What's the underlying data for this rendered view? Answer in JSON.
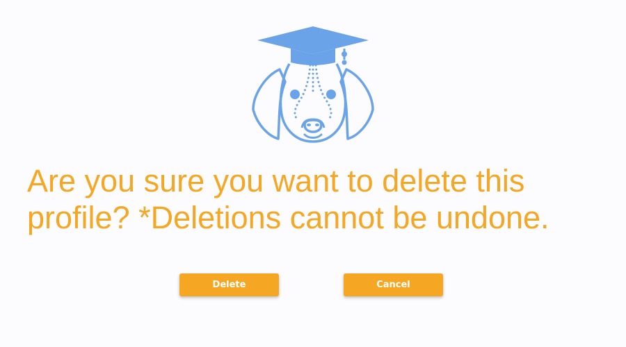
{
  "logo": {
    "icon": "graduation-cap-dog-icon",
    "color": "#6aa3e8"
  },
  "dialog": {
    "message": "Are you sure you want to delete this profile? *Deletions cannot be undone.",
    "accent_color": "#f5a623"
  },
  "buttons": {
    "delete_label": "Delete",
    "cancel_label": "Cancel"
  }
}
